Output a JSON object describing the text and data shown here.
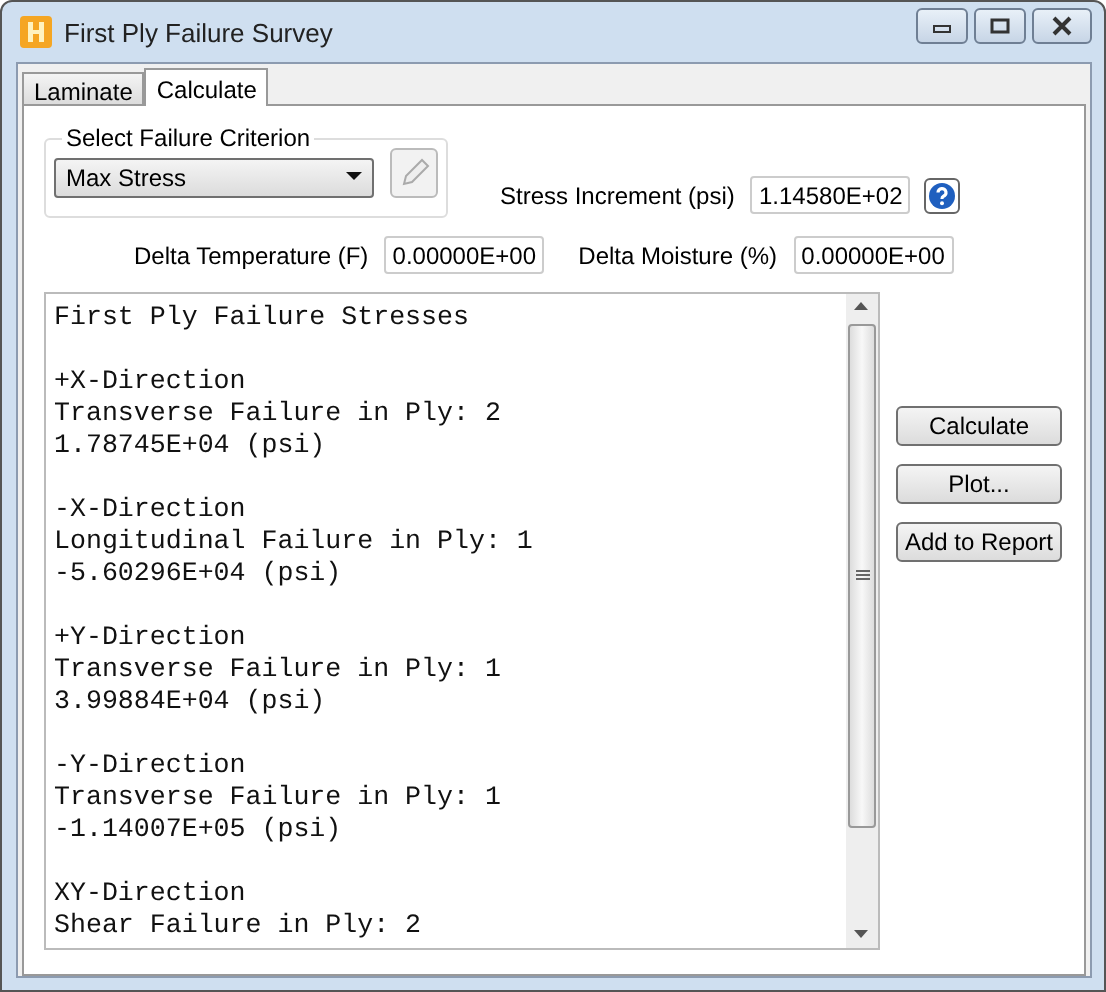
{
  "window": {
    "title": "First Ply Failure Survey"
  },
  "tabs": [
    {
      "label": "Laminate",
      "selected": false
    },
    {
      "label": "Calculate",
      "selected": true
    }
  ],
  "criterion": {
    "group_label": "Select Failure Criterion",
    "value": "Max Stress"
  },
  "fields": [
    {
      "label": "Stress Increment (psi)",
      "value": "1.14580E+02",
      "help": true
    },
    {
      "label": "Delta Temperature (F)",
      "value": "0.00000E+00",
      "help": false
    },
    {
      "label": "Delta Moisture (%)",
      "value": "0.00000E+00",
      "help": false
    }
  ],
  "results": {
    "title": "First Ply Failure Stresses",
    "sections": [
      [
        "+X-Direction",
        "Transverse Failure in Ply: 2",
        "1.78745E+04 (psi)"
      ],
      [
        "-X-Direction",
        "Longitudinal Failure in Ply: 1",
        "-5.60296E+04 (psi)"
      ],
      [
        "+Y-Direction",
        "Transverse Failure in Ply: 1",
        "3.99884E+04 (psi)"
      ],
      [
        "-Y-Direction",
        "Transverse Failure in Ply: 1",
        "-1.14007E+05 (psi)"
      ],
      [
        "XY-Direction",
        "Shear Failure in Ply: 2"
      ]
    ]
  },
  "buttons": [
    "Calculate",
    "Plot...",
    "Add to Report"
  ]
}
